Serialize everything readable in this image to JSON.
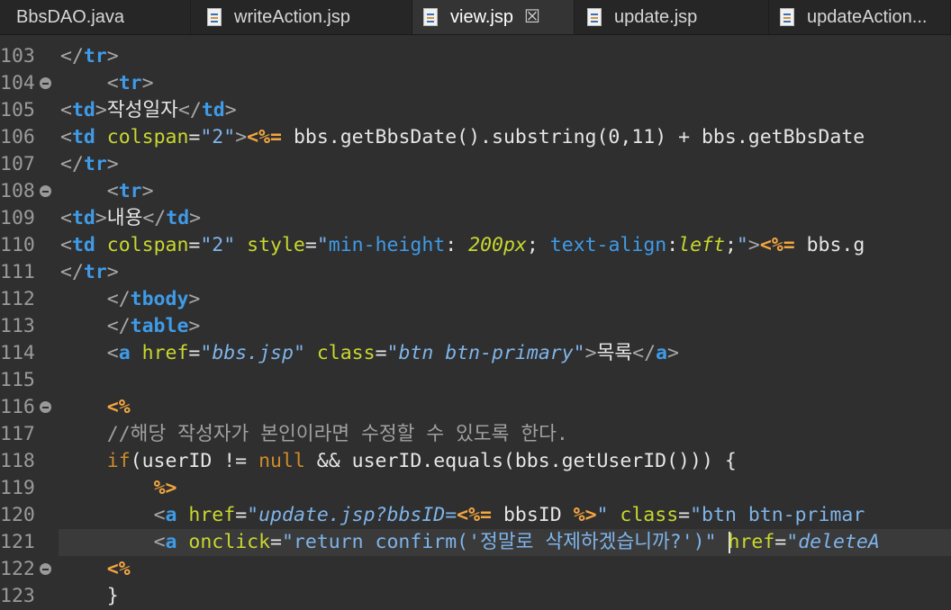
{
  "tabs": [
    {
      "label": "BbsDAO.java",
      "icon": "java-file-icon",
      "active": false
    },
    {
      "label": "writeAction.jsp",
      "icon": "jsp-file-icon",
      "active": false
    },
    {
      "label": "view.jsp",
      "icon": "jsp-file-icon",
      "active": true,
      "close": "☒"
    },
    {
      "label": "update.jsp",
      "icon": "jsp-file-icon",
      "active": false
    },
    {
      "label": "updateAction...",
      "icon": "jsp-file-icon",
      "active": false
    }
  ],
  "colors": {
    "background": "#2f2f2f",
    "tag": "#3f9be8",
    "attribute": "#c9d72f",
    "string": "#7fb4ea",
    "jsp_delimiter": "#f4a640",
    "keyword": "#cf8a2a",
    "line_number": "#9a9a9a"
  },
  "current_line": "121",
  "lines": [
    {
      "n": "103",
      "fold": false,
      "tokens": [
        [
          "brk",
          "</"
        ],
        [
          "tag",
          "tr"
        ],
        [
          "brk",
          ">"
        ]
      ]
    },
    {
      "n": "104",
      "fold": true,
      "tokens": [
        [
          "txt",
          "    "
        ],
        [
          "brk",
          "<"
        ],
        [
          "tag",
          "tr"
        ],
        [
          "brk",
          ">"
        ]
      ]
    },
    {
      "n": "105",
      "fold": false,
      "tokens": [
        [
          "brk",
          "<"
        ],
        [
          "tag",
          "td"
        ],
        [
          "brk",
          ">"
        ],
        [
          "txt",
          "작성일자"
        ],
        [
          "brk",
          "</"
        ],
        [
          "tag",
          "td"
        ],
        [
          "brk",
          ">"
        ]
      ]
    },
    {
      "n": "106",
      "fold": false,
      "tokens": [
        [
          "brk",
          "<"
        ],
        [
          "tag",
          "td"
        ],
        [
          "txt",
          " "
        ],
        [
          "attr",
          "colspan"
        ],
        [
          "txt",
          "="
        ],
        [
          "str",
          "\"2\""
        ],
        [
          "brk",
          ">"
        ],
        [
          "jsp",
          "<%="
        ],
        [
          "txt",
          " bbs.getBbsDate().substring(0,11) + bbs.getBbsDate"
        ]
      ]
    },
    {
      "n": "107",
      "fold": false,
      "tokens": [
        [
          "brk",
          "</"
        ],
        [
          "tag",
          "tr"
        ],
        [
          "brk",
          ">"
        ]
      ]
    },
    {
      "n": "108",
      "fold": true,
      "tokens": [
        [
          "txt",
          "    "
        ],
        [
          "brk",
          "<"
        ],
        [
          "tag",
          "tr"
        ],
        [
          "brk",
          ">"
        ]
      ]
    },
    {
      "n": "109",
      "fold": false,
      "tokens": [
        [
          "brk",
          "<"
        ],
        [
          "tag",
          "td"
        ],
        [
          "brk",
          ">"
        ],
        [
          "txt",
          "내용"
        ],
        [
          "brk",
          "</"
        ],
        [
          "tag",
          "td"
        ],
        [
          "brk",
          ">"
        ]
      ]
    },
    {
      "n": "110",
      "fold": false,
      "tokens": [
        [
          "brk",
          "<"
        ],
        [
          "tag",
          "td"
        ],
        [
          "txt",
          " "
        ],
        [
          "attr",
          "colspan"
        ],
        [
          "txt",
          "="
        ],
        [
          "str",
          "\"2\""
        ],
        [
          "txt",
          " "
        ],
        [
          "attr",
          "style"
        ],
        [
          "txt",
          "="
        ],
        [
          "str",
          "\""
        ],
        [
          "sprop",
          "min-height"
        ],
        [
          "txt",
          ": "
        ],
        [
          "sval",
          "200px"
        ],
        [
          "txt",
          "; "
        ],
        [
          "sprop",
          "text-align"
        ],
        [
          "txt",
          ":"
        ],
        [
          "sval",
          "left"
        ],
        [
          "txt",
          ";"
        ],
        [
          "str",
          "\""
        ],
        [
          "brk",
          ">"
        ],
        [
          "jsp",
          "<%="
        ],
        [
          "txt",
          " bbs.g"
        ]
      ]
    },
    {
      "n": "111",
      "fold": false,
      "tokens": [
        [
          "brk",
          "</"
        ],
        [
          "tag",
          "tr"
        ],
        [
          "brk",
          ">"
        ]
      ]
    },
    {
      "n": "112",
      "fold": false,
      "tokens": [
        [
          "txt",
          "    "
        ],
        [
          "brk",
          "</"
        ],
        [
          "tag",
          "tbody"
        ],
        [
          "brk",
          ">"
        ]
      ]
    },
    {
      "n": "113",
      "fold": false,
      "tokens": [
        [
          "txt",
          "    "
        ],
        [
          "brk",
          "</"
        ],
        [
          "tag",
          "table"
        ],
        [
          "brk",
          ">"
        ]
      ]
    },
    {
      "n": "114",
      "fold": false,
      "tokens": [
        [
          "txt",
          "    "
        ],
        [
          "brk",
          "<"
        ],
        [
          "tag",
          "a"
        ],
        [
          "txt",
          " "
        ],
        [
          "attr",
          "href"
        ],
        [
          "txt",
          "="
        ],
        [
          "str",
          "\""
        ],
        [
          "istr",
          "bbs.jsp"
        ],
        [
          "str",
          "\""
        ],
        [
          "txt",
          " "
        ],
        [
          "attr",
          "class"
        ],
        [
          "txt",
          "="
        ],
        [
          "str",
          "\""
        ],
        [
          "istr",
          "btn btn-primary"
        ],
        [
          "str",
          "\""
        ],
        [
          "brk",
          ">"
        ],
        [
          "txt",
          "목록"
        ],
        [
          "brk",
          "</"
        ],
        [
          "tag",
          "a"
        ],
        [
          "brk",
          ">"
        ]
      ]
    },
    {
      "n": "115",
      "fold": false,
      "tokens": []
    },
    {
      "n": "116",
      "fold": true,
      "tokens": [
        [
          "txt",
          "    "
        ],
        [
          "jsp",
          "<%"
        ]
      ]
    },
    {
      "n": "117",
      "fold": false,
      "tokens": [
        [
          "txt",
          "    "
        ],
        [
          "cmt",
          "//해당 작성자가 본인이라면 수정할 수 있도록 한다."
        ]
      ]
    },
    {
      "n": "118",
      "fold": false,
      "tokens": [
        [
          "txt",
          "    "
        ],
        [
          "kw",
          "if"
        ],
        [
          "txt",
          "(userID != "
        ],
        [
          "kw",
          "null"
        ],
        [
          "txt",
          " && userID.equals(bbs.getUserID())) {"
        ]
      ]
    },
    {
      "n": "119",
      "fold": false,
      "tokens": [
        [
          "txt",
          "        "
        ],
        [
          "jsp",
          "%>"
        ]
      ]
    },
    {
      "n": "120",
      "fold": false,
      "tokens": [
        [
          "txt",
          "        "
        ],
        [
          "brk",
          "<"
        ],
        [
          "tag",
          "a"
        ],
        [
          "txt",
          " "
        ],
        [
          "attr",
          "href"
        ],
        [
          "txt",
          "="
        ],
        [
          "str",
          "\""
        ],
        [
          "istr",
          "update.jsp?bbsID="
        ],
        [
          "jsp",
          "<%="
        ],
        [
          "txt",
          " bbsID "
        ],
        [
          "jsp",
          "%>"
        ],
        [
          "str",
          "\""
        ],
        [
          "txt",
          " "
        ],
        [
          "attr",
          "class"
        ],
        [
          "txt",
          "="
        ],
        [
          "str",
          "\"btn btn-primar"
        ]
      ]
    },
    {
      "n": "121",
      "fold": false,
      "tokens": [
        [
          "txt",
          "        "
        ],
        [
          "brk",
          "<"
        ],
        [
          "tag",
          "a"
        ],
        [
          "txt",
          " "
        ],
        [
          "attr",
          "onclick"
        ],
        [
          "txt",
          "="
        ],
        [
          "str",
          "\"return confirm('정말로 삭제하겠습니까?')\""
        ],
        [
          "txt",
          " "
        ],
        [
          "cursor",
          ""
        ],
        [
          "attr",
          "href"
        ],
        [
          "txt",
          "="
        ],
        [
          "str",
          "\""
        ],
        [
          "istr",
          "deleteA"
        ]
      ]
    },
    {
      "n": "122",
      "fold": true,
      "tokens": [
        [
          "txt",
          "    "
        ],
        [
          "jsp",
          "<%"
        ]
      ]
    },
    {
      "n": "123",
      "fold": false,
      "tokens": [
        [
          "txt",
          "    }"
        ]
      ]
    }
  ]
}
